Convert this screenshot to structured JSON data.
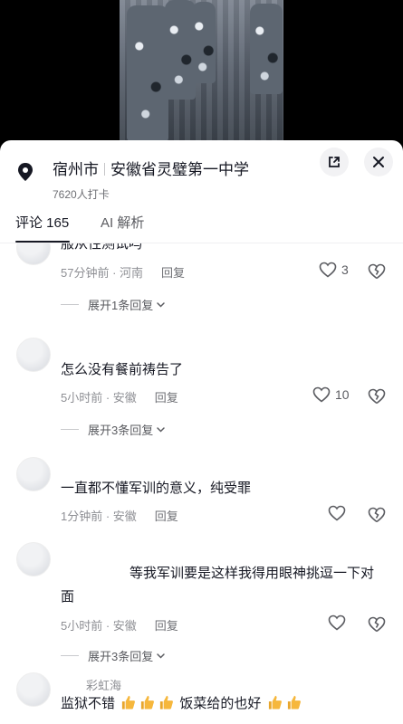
{
  "location": {
    "city": "宿州市",
    "school": "安徽省灵璧第一中学",
    "checkins": "7620人打卡"
  },
  "tabs": [
    {
      "label": "评论 165"
    },
    {
      "label": "AI 解析"
    }
  ],
  "comments": [
    {
      "username": "",
      "text": "服从性测试吗",
      "time": "57分钟前 · 河南",
      "reply": "回复",
      "likes": "3",
      "expand": "展开1条回复"
    },
    {
      "username": "",
      "text": "怎么没有餐前祷告了",
      "time": "5小时前 · 安徽",
      "reply": "回复",
      "likes": "10",
      "expand": "展开3条回复"
    },
    {
      "username": "",
      "text": "一直都不懂军训的意义，纯受罪",
      "time": "1分钟前 · 安徽",
      "reply": "回复",
      "likes": "",
      "expand": ""
    },
    {
      "username": "",
      "text": "等我军训要是这样我得用眼神挑逗一下对面",
      "time": "5小时前 · 安徽",
      "reply": "回复",
      "likes": "",
      "expand": "展开3条回复"
    },
    {
      "username": "彩虹海",
      "text_a": "监狱不错",
      "text_b": "饭菜给的也好",
      "emoji": "thumbs-up",
      "time": "",
      "reply": "",
      "likes": "",
      "expand": ""
    }
  ],
  "icons": [
    "location-pin-icon",
    "expand-icon",
    "close-icon",
    "heart-icon",
    "broken-heart-icon",
    "chevron-down-icon",
    "thumbs-up-icon"
  ],
  "colors": {
    "text": "#161823",
    "meta": "#8e8f94",
    "thumb": "#f6b73c"
  }
}
